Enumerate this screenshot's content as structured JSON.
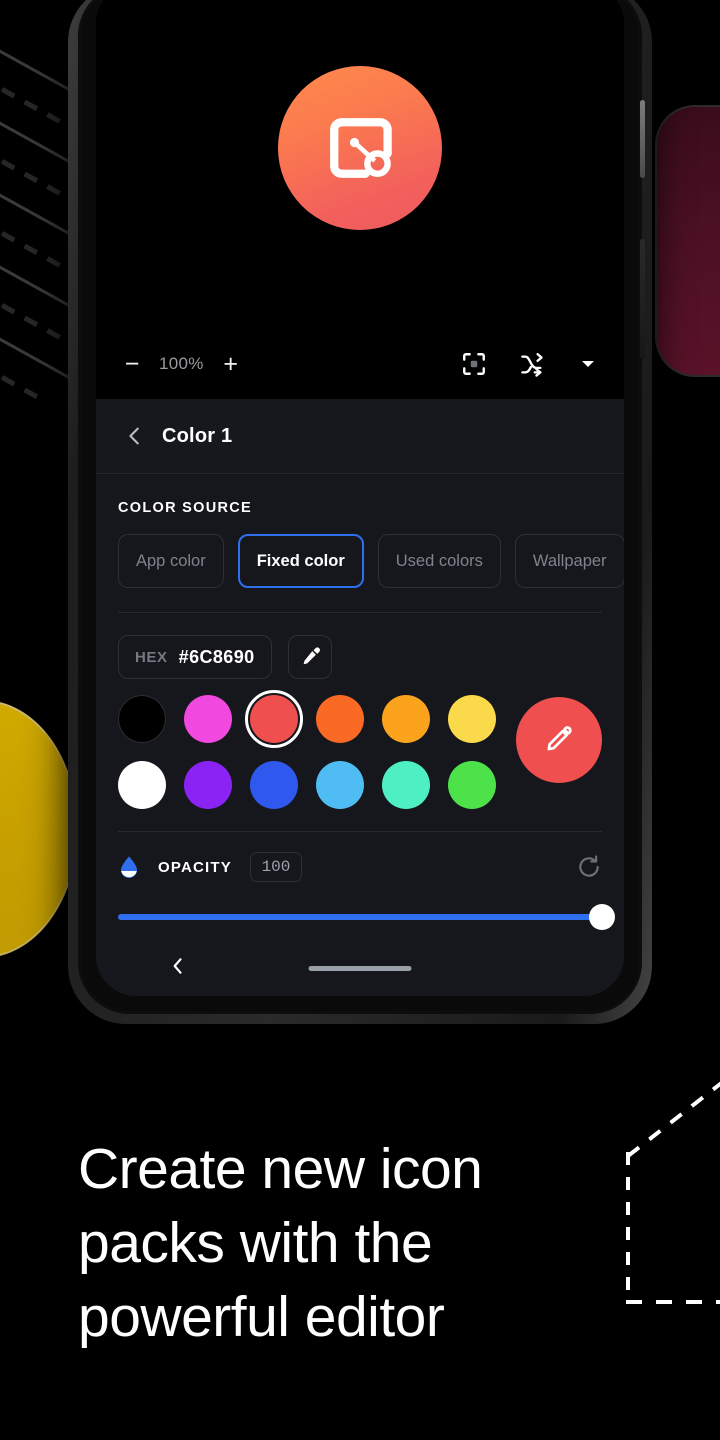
{
  "caption": {
    "line1": "Create new icon",
    "line2": "packs with the",
    "line3": "powerful editor"
  },
  "app_icon": {
    "name": "app-logo-icon",
    "gradient_start": "#ff8a4c",
    "gradient_end": "#ee5a5e"
  },
  "toolbar": {
    "zoom_out_label": "−",
    "zoom_value": "100%",
    "zoom_in_label": "+",
    "fit_icon": "crop-frame-icon",
    "shuffle_icon": "shuffle-icon",
    "caret_icon": "chevron-down-icon"
  },
  "sheet": {
    "back_label": "‹",
    "title": "Color 1",
    "section_label": "COLOR SOURCE",
    "sources": [
      {
        "label": "App color",
        "selected": false
      },
      {
        "label": "Fixed color",
        "selected": true
      },
      {
        "label": "Used colors",
        "selected": false
      },
      {
        "label": "Wallpaper",
        "selected": false
      }
    ],
    "hex": {
      "label": "HEX",
      "value": "#6C8690",
      "eyedropper_icon": "eyedropper-icon"
    },
    "swatches": [
      {
        "color": "#000000",
        "selected": false,
        "name": "swatch-black"
      },
      {
        "color": "#f148e0",
        "selected": false,
        "name": "swatch-magenta"
      },
      {
        "color": "#ef4f4f",
        "selected": true,
        "name": "swatch-red"
      },
      {
        "color": "#fa6a25",
        "selected": false,
        "name": "swatch-orange"
      },
      {
        "color": "#fba31c",
        "selected": false,
        "name": "swatch-amber"
      },
      {
        "color": "#fada4a",
        "selected": false,
        "name": "swatch-yellow"
      },
      {
        "color": "#ffffff",
        "selected": false,
        "name": "swatch-white"
      },
      {
        "color": "#8b23f5",
        "selected": false,
        "name": "swatch-purple"
      },
      {
        "color": "#2f58ef",
        "selected": false,
        "name": "swatch-blue"
      },
      {
        "color": "#4fbdf3",
        "selected": false,
        "name": "swatch-sky"
      },
      {
        "color": "#4ef0c3",
        "selected": false,
        "name": "swatch-turquoise"
      },
      {
        "color": "#4de24a",
        "selected": false,
        "name": "swatch-green"
      }
    ],
    "edit_fab": {
      "color": "#ef4f4f",
      "icon": "pencil-icon"
    },
    "opacity": {
      "icon": "droplet-icon",
      "label": "OPACITY",
      "value": "100",
      "percent": 100,
      "accent": "#2f6fef",
      "reset_icon": "reset-icon"
    }
  },
  "navbar": {
    "back_icon": "nav-back-icon",
    "home_indicator": "home-indicator"
  }
}
